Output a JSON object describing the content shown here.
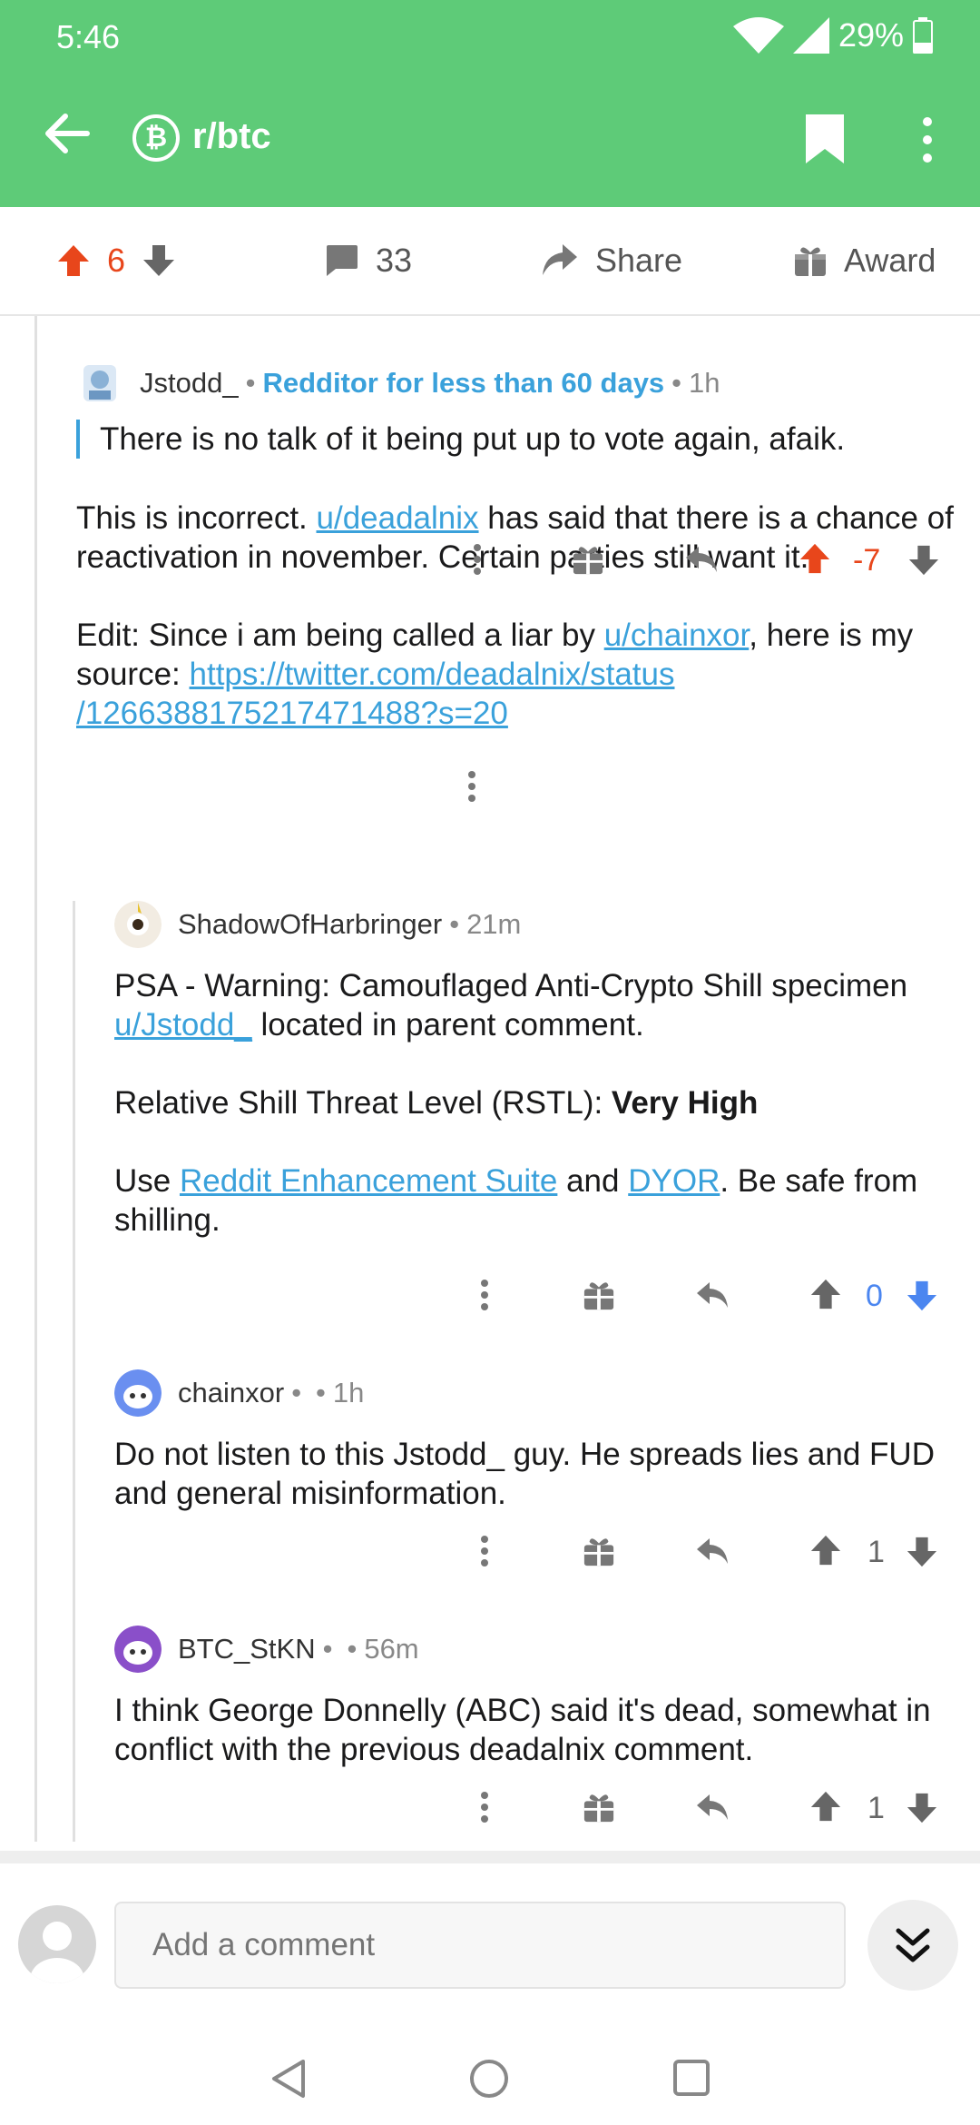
{
  "status": {
    "time": "5:46",
    "battery": "29%"
  },
  "appbar": {
    "subreddit": "r/btc",
    "sub_glyph": "₿"
  },
  "actions": {
    "score": "6",
    "comments": "33",
    "share_label": "Share",
    "award_label": "Award"
  },
  "comments": [
    {
      "author": "Jstodd_",
      "flair": "Redditor for less than 60 days",
      "age": "1h",
      "quote": "There is no talk of it being put up to vote again, afaik.",
      "p1_pre": "This is incorrect. ",
      "p1_link": "u/deadalnix",
      "p1_post": " has said that there is a chance of reactivation in november. Certain parties still want it.",
      "p2_pre": "Edit: Since i am being called a liar by ",
      "p2_link": "u/chainxor",
      "p2_mid": ", here is my source: ",
      "p2_url_a": "https://twitter.com/deadalnix/status",
      "p2_url_b": "/1266388175217471488?s=20",
      "score": "-7"
    },
    {
      "author": "ShadowOfHarbringer",
      "age": "21m",
      "p1_pre": "PSA - Warning: Camouflaged Anti-Crypto Shill specimen ",
      "p1_link": "u/Jstodd_",
      "p1_post": " located in parent comment.",
      "p2_pre": "Relative Shill Threat Level (RSTL): ",
      "p2_bold": "Very High",
      "p3_pre": "Use ",
      "p3_link1": "Reddit Enhancement Suite",
      "p3_mid": " and ",
      "p3_link2": "DYOR",
      "p3_post": ". Be safe from shilling.",
      "score": "0"
    },
    {
      "author": "chainxor",
      "age": "1h",
      "body": "Do not listen to this Jstodd_ guy. He spreads lies and FUD and general misinformation.",
      "score": "1"
    },
    {
      "author": "BTC_StKN",
      "age": "56m",
      "body": "I think George Donnelly (ABC) said it's dead, somewhat in conflict with the previous deadalnix comment.",
      "score": "1"
    }
  ],
  "compose": {
    "placeholder": "Add a comment"
  },
  "colors": {
    "header": "#5ecb78",
    "upvote": "#e8461b",
    "downvote": "#4b86f0",
    "link": "#3aa1db"
  }
}
